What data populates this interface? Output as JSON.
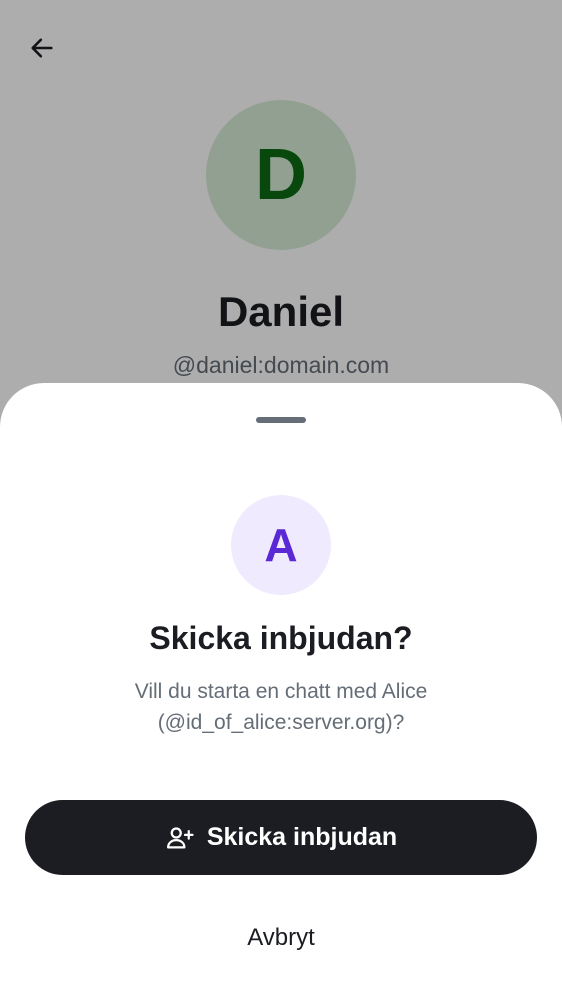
{
  "profile": {
    "avatar_letter": "D",
    "name": "Daniel",
    "user_id": "@daniel:domain.com"
  },
  "sheet": {
    "avatar_letter": "A",
    "title": "Skicka inbjudan?",
    "message_line1": "Vill du starta en chatt med Alice",
    "message_line2": "(@id_of_alice:server.org)?",
    "primary_button_label": "Skicka inbjudan",
    "primary_button_icon": "person-add-icon",
    "cancel_label": "Avbryt"
  },
  "colors": {
    "profile_avatar_bg": "#d6ecd6",
    "profile_avatar_fg": "#0d6b14",
    "invite_avatar_bg": "#efeafd",
    "invite_avatar_fg": "#5a28d4",
    "primary_button_bg": "#1b1d22",
    "primary_text": "#1b1d22",
    "secondary_text": "#656d77"
  }
}
